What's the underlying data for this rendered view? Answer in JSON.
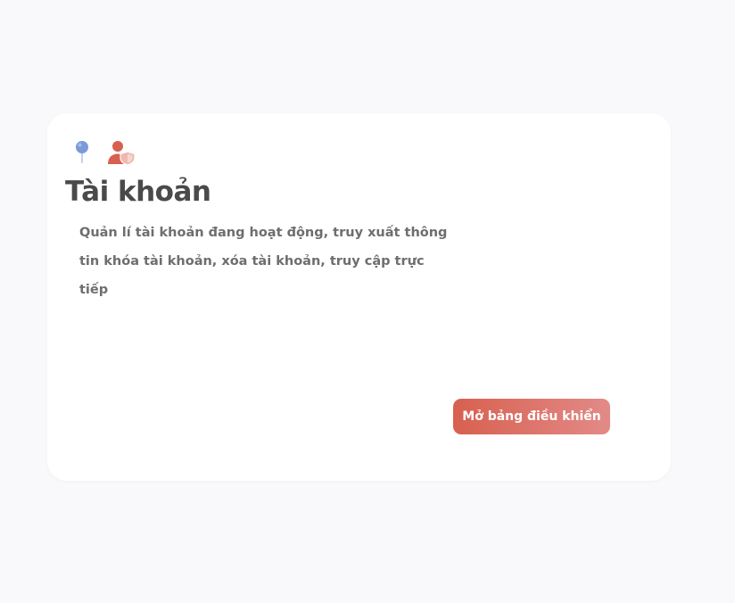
{
  "card": {
    "title": "Tài khoản",
    "description": "Quản lí tài khoản đang hoạt động, truy xuất thông tin khóa tài khoản, xóa tài khoản, truy cập trực tiếp",
    "button_label": "Mở bảng điều khiển",
    "icons": [
      "pin-icon",
      "user-shield-icon"
    ]
  },
  "colors": {
    "background": "#f9f9fc",
    "card": "#ffffff",
    "title": "#4a4a4a",
    "description": "#6e6e6e",
    "pin": "#7b9bd6",
    "user": "#d8604f",
    "shield": "#efb8b0",
    "button_start": "#d8604f",
    "button_end": "#e28a88"
  }
}
